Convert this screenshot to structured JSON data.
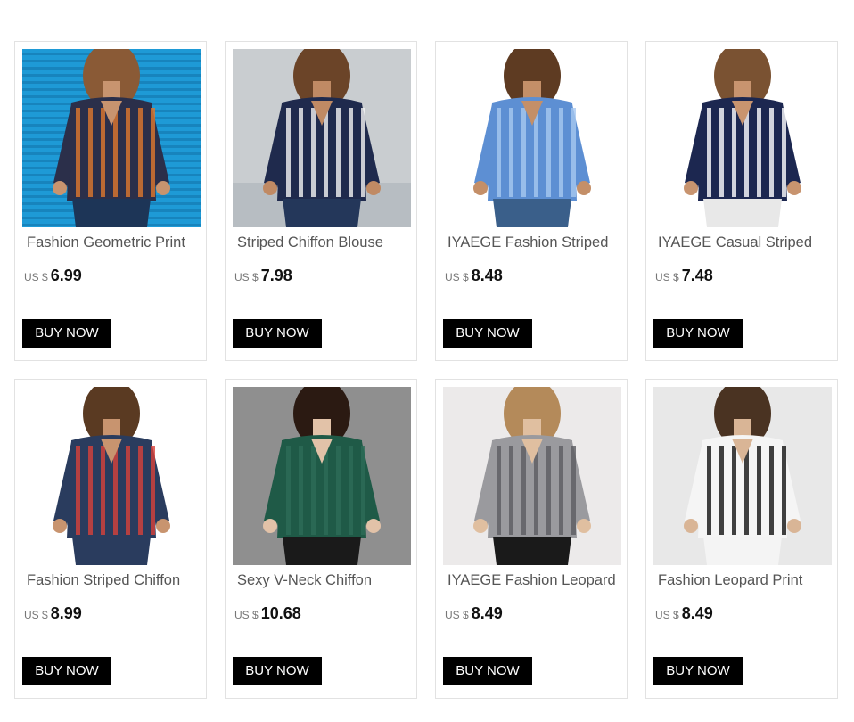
{
  "products": [
    {
      "title": "Fashion Geometric Print",
      "currency": "US $",
      "price": "6.99",
      "button": "BUY NOW",
      "photo_colors": {
        "bg": "#1e9ad6",
        "top": "#2b2f4a",
        "accent": "#e0782d",
        "bottom": "#1d3557",
        "skin": "#c8946f",
        "hair": "#8a5a36"
      }
    },
    {
      "title": "Striped Chiffon Blouse",
      "currency": "US $",
      "price": "7.98",
      "button": "BUY NOW",
      "photo_colors": {
        "bg": "#c9cdd0",
        "top": "#1f2a4d",
        "accent": "#f4f4f4",
        "bottom": "#24375a",
        "skin": "#c08a64",
        "hair": "#6b4428"
      }
    },
    {
      "title": "IYAEGE Fashion Striped",
      "currency": "US $",
      "price": "8.48",
      "button": "BUY NOW",
      "photo_colors": {
        "bg": "#ffffff",
        "top": "#5d8fd3",
        "accent": "#a8c8f0",
        "bottom": "#3a5f8a",
        "skin": "#c48f68",
        "hair": "#5e3b22"
      }
    },
    {
      "title": "IYAEGE Casual Striped",
      "currency": "US $",
      "price": "7.48",
      "button": "BUY NOW",
      "photo_colors": {
        "bg": "#ffffff",
        "top": "#1c2750",
        "accent": "#ffffff",
        "bottom": "#e8e8e8",
        "skin": "#c8946f",
        "hair": "#7a5232"
      }
    },
    {
      "title": "Fashion Striped Chiffon",
      "currency": "US $",
      "price": "8.99",
      "button": "BUY NOW",
      "photo_colors": {
        "bg": "#ffffff",
        "top": "#2a3c5e",
        "accent": "#d8413a",
        "bottom": "#2a3c5e",
        "skin": "#c8946f",
        "hair": "#5a3a22"
      }
    },
    {
      "title": "Sexy V-Neck Chiffon",
      "currency": "US $",
      "price": "10.68",
      "button": "BUY NOW",
      "photo_colors": {
        "bg": "#8f8f8f",
        "top": "#1f5a47",
        "accent": "#2d6b57",
        "bottom": "#1a1a1a",
        "skin": "#e2c2a8",
        "hair": "#2b1a12"
      }
    },
    {
      "title": "IYAEGE Fashion Leopard",
      "currency": "US $",
      "price": "8.49",
      "button": "BUY NOW",
      "photo_colors": {
        "bg": "#eceaea",
        "top": "#9a9a9e",
        "accent": "#5b5b60",
        "bottom": "#1a1a1a",
        "skin": "#e0bfa0",
        "hair": "#b48a5a"
      }
    },
    {
      "title": "Fashion Leopard Print",
      "currency": "US $",
      "price": "8.49",
      "button": "BUY NOW",
      "photo_colors": {
        "bg": "#e8e8e8",
        "top": "#f5f5f5",
        "accent": "#111111",
        "bottom": "#f4f4f4",
        "skin": "#d9b596",
        "hair": "#4a3322"
      }
    }
  ]
}
